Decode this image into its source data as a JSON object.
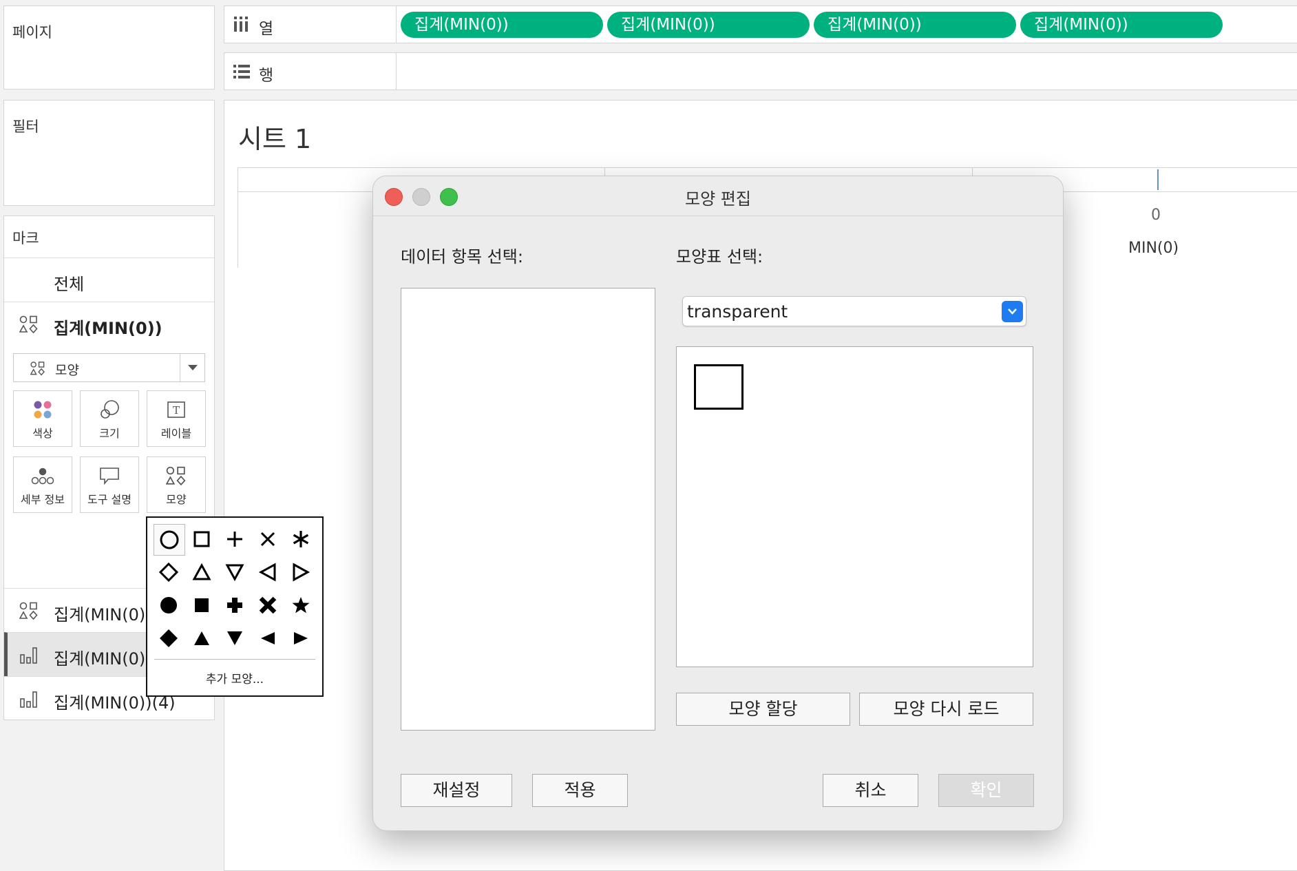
{
  "left_panel": {
    "pages_title": "페이지",
    "filters_title": "필터",
    "marks_title": "마크",
    "marks_all": "전체",
    "marks_active_field": "집계(MIN(0))",
    "mark_type": "모양",
    "mark_buttons": [
      "색상",
      "크기",
      "레이블",
      "세부 정보",
      "도구 설명",
      "모양"
    ],
    "field_rows": [
      "집계(MIN(0))",
      "집계(MIN(0))",
      "집계(MIN(0))(4)"
    ]
  },
  "shelves": {
    "columns_label": "열",
    "rows_label": "행",
    "column_pills": [
      "집계(MIN(0))",
      "집계(MIN(0))",
      "집계(MIN(0))",
      "집계(MIN(0))"
    ]
  },
  "sheet": {
    "title": "시트 1",
    "axis_tick": "0",
    "axis_label": "MIN(0)"
  },
  "shape_palette": {
    "icons": [
      "circle-outline",
      "square-outline",
      "plus",
      "cross",
      "asterisk",
      "diamond-outline",
      "triangle-up-outline",
      "triangle-down-outline",
      "triangle-left-outline",
      "triangle-right-outline",
      "circle-filled",
      "square-filled",
      "plus-filled",
      "cross-filled",
      "star-filled",
      "diamond-filled",
      "triangle-up-filled",
      "triangle-down-filled",
      "triangle-left-filled",
      "triangle-right-filled"
    ],
    "more_shapes": "추가 모양..."
  },
  "dialog": {
    "title": "모양 편집",
    "data_item_label": "데이터 항목 선택:",
    "palette_label": "모양표 선택:",
    "palette_selected": "transparent",
    "assign_button": "모양 할당",
    "reload_button": "모양 다시 로드",
    "reset_button": "재설정",
    "apply_button": "적용",
    "cancel_button": "취소",
    "ok_button": "확인",
    "colors": {
      "close": "#ee5f57",
      "minimize": "#cfcfcf",
      "maximize": "#3fbf4c",
      "dropdown": "#1d7cf2"
    }
  },
  "theme": {
    "pill_green": "#00b180"
  }
}
